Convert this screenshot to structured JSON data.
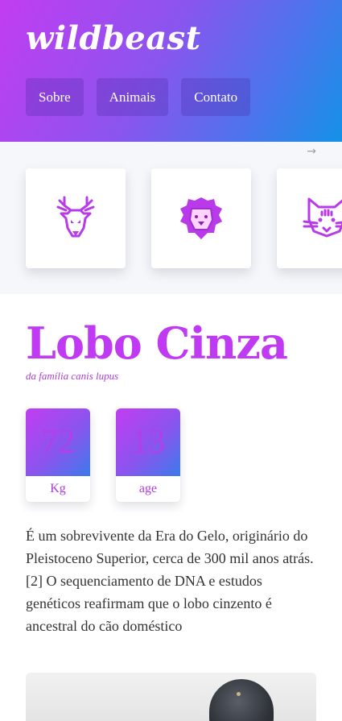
{
  "header": {
    "logo": "wildbeast",
    "nav": [
      {
        "label": "Sobre"
      },
      {
        "label": "Animais"
      },
      {
        "label": "Contato"
      }
    ]
  },
  "gallery": {
    "scroll_hint": "→",
    "cards": [
      {
        "icon": "deer-icon"
      },
      {
        "icon": "lion-icon"
      },
      {
        "icon": "cat-icon"
      }
    ]
  },
  "animal": {
    "name": "Lobo Cinza",
    "family": "da família canis lupus",
    "stats": [
      {
        "value": "72",
        "label": "Kg"
      },
      {
        "value": "13",
        "label": "age"
      }
    ],
    "description": "É um sobrevivente da Era do Gelo, originário do Pleistoceno Superior, cerca de 300 mil anos atrás.[2] O sequenciamento de DNA e estudos genéticos reafirmam que o lobo cinzento é ancestral do cão doméstico"
  },
  "colors": {
    "accent": "#c03af4",
    "gradient_start": "#c23cf2",
    "gradient_end": "#1592e8",
    "icon_fill": "#b83ae8"
  }
}
